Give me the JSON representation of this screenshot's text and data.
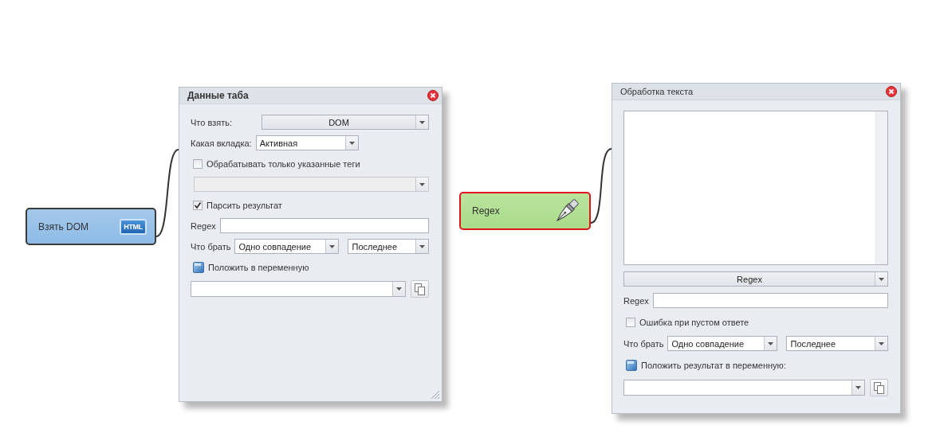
{
  "nodes": [
    {
      "label": "Взять DOM",
      "kind": "html",
      "badge": "HTML",
      "color": "#8dbbe6",
      "selected": false
    },
    {
      "label": "Regex",
      "kind": "pen",
      "color": "#a9dc88",
      "selected": true
    }
  ],
  "panels": [
    {
      "title": "Данные таба",
      "active": true,
      "resizable": true,
      "fields": [
        {
          "kind": "mode-select",
          "label": "Что взять:",
          "value": "DOM"
        },
        {
          "kind": "select",
          "label": "Какая вкладка:",
          "value": "Активная"
        },
        {
          "kind": "checkbox",
          "label": "Обрабатывать только указанные теги",
          "checked": false
        },
        {
          "kind": "tag-select",
          "disabled": true
        },
        {
          "kind": "checkbox",
          "label": "Парсить результат",
          "checked": true
        },
        {
          "kind": "input",
          "label": "Regex"
        },
        {
          "kind": "two-selects",
          "label": "Что брать",
          "values": [
            "Одно совпадение",
            "Последнее"
          ]
        },
        {
          "kind": "variable",
          "label": "Положить в переменную"
        },
        {
          "kind": "variable-combo"
        }
      ]
    },
    {
      "title": "Обработка текста",
      "active": false,
      "resizable": false,
      "fields": [
        {
          "kind": "text-area"
        },
        {
          "kind": "mode-select",
          "value": "Regex"
        },
        {
          "kind": "input",
          "label": "Regex"
        },
        {
          "kind": "checkbox",
          "label": "Ошибка при пустом ответе",
          "checked": false
        },
        {
          "kind": "two-selects",
          "label": "Что брать",
          "values": [
            "Одно совпадение",
            "Последнее"
          ]
        },
        {
          "kind": "variable",
          "label": "Положить результат в переменную:"
        },
        {
          "kind": "variable-combo"
        }
      ]
    }
  ]
}
